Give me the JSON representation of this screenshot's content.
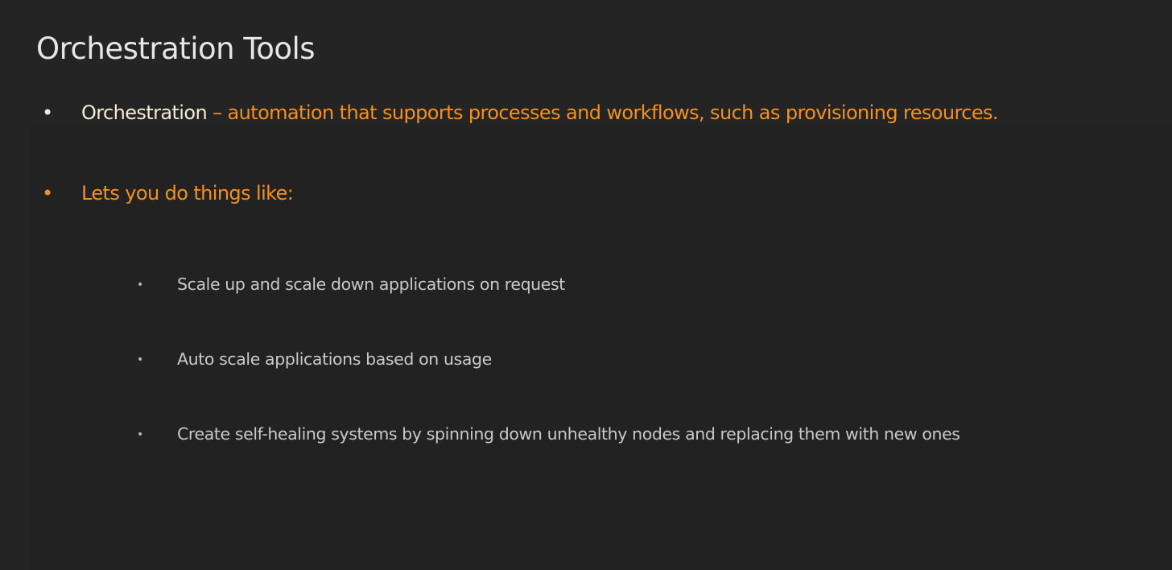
{
  "title": "Orchestration Tools",
  "colors": {
    "background": "#242424",
    "accent": "#f5901f",
    "term": "#f3ead8",
    "subtext": "#c9c9c9"
  },
  "bullets": [
    {
      "marker": "•",
      "term": "Orchestration",
      "definition": " – automation that supports processes and workflows, such as provisioning resources."
    },
    {
      "marker": "•",
      "text": "Lets you do things like:"
    }
  ],
  "sub_bullets": [
    {
      "marker": "•",
      "text": "Scale up and scale down applications on request"
    },
    {
      "marker": "•",
      "text": "Auto scale applications based on usage"
    },
    {
      "marker": "•",
      "text": "Create self-healing systems by spinning down unhealthy nodes and replacing them with new ones"
    }
  ]
}
